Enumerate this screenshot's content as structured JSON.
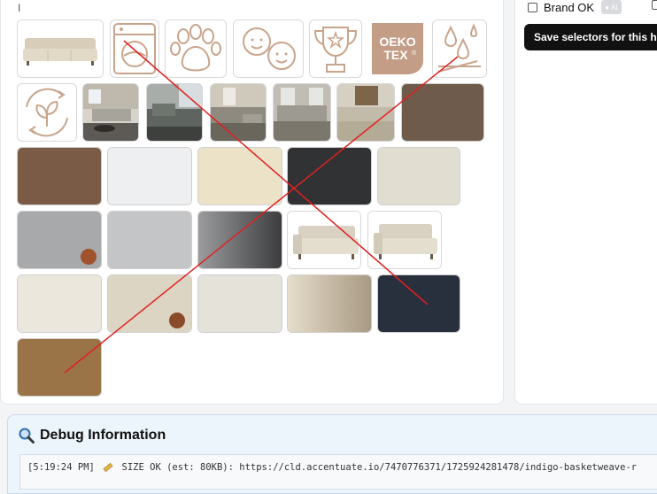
{
  "left_panel": {
    "text_cursor": "I",
    "oeko_badge": {
      "line1": "OEKO",
      "line2": "TEX",
      "registered": "®"
    },
    "images": [
      {
        "name": "sofa-product-image"
      },
      {
        "name": "washable-icon-image"
      },
      {
        "name": "pet-friendly-icon-image"
      },
      {
        "name": "kid-friendly-icon-image"
      },
      {
        "name": "award-trophy-icon-image"
      },
      {
        "name": "oeko-tex-badge-image"
      },
      {
        "name": "water-repellent-icon-image"
      },
      {
        "name": "sustainable-icon-image"
      },
      {
        "name": "room-photo-1"
      },
      {
        "name": "room-photo-2"
      },
      {
        "name": "room-photo-3"
      },
      {
        "name": "room-photo-4"
      },
      {
        "name": "room-photo-5"
      },
      {
        "name": "swatch-brown-1"
      },
      {
        "name": "swatch-brown-2"
      },
      {
        "name": "swatch-white"
      },
      {
        "name": "swatch-cream"
      },
      {
        "name": "swatch-charcoal"
      },
      {
        "name": "swatch-oatmeal"
      },
      {
        "name": "swatch-gray-penny"
      },
      {
        "name": "swatch-light-gray"
      },
      {
        "name": "swatch-dark-gray"
      },
      {
        "name": "sofa-side-view-1"
      },
      {
        "name": "sofa-side-view-2"
      },
      {
        "name": "swatch-ivory"
      },
      {
        "name": "swatch-natural-penny"
      },
      {
        "name": "swatch-off-white"
      },
      {
        "name": "swatch-boucle"
      },
      {
        "name": "swatch-indigo"
      },
      {
        "name": "swatch-camel"
      }
    ],
    "colors": {
      "icon_tan": "#c9a48c",
      "oeko_bg": "#c39d86",
      "brown_1": "#6e5b4b",
      "brown_2": "#7a5b45",
      "white": "#eeeff0",
      "cream": "#ece2c8",
      "charcoal": "#303234",
      "oatmeal": "#e1ddd0",
      "gray_penny": "#a8a9ab",
      "light_gray": "#c4c5c6",
      "dark_gray": "#7d7e80",
      "ivory": "#ebe7dc",
      "natural": "#dcd5c4",
      "off_white": "#e4e2d9",
      "boucle": "#cdc2ad",
      "indigo": "#27303c",
      "camel": "#9a7447",
      "overlay_line": "#e02020"
    }
  },
  "right_panel": {
    "brand_ok_label": "Brand OK",
    "ai_badge_label": "AI",
    "save_button_label": "Save selectors for this h"
  },
  "debug": {
    "title": "Debug Information",
    "log_time": "[5:19:24 PM]",
    "log_text": "SIZE OK (est: 80KB): https://cld.accentuate.io/7470776371/1725924281478/indigo-basketweave-r"
  }
}
